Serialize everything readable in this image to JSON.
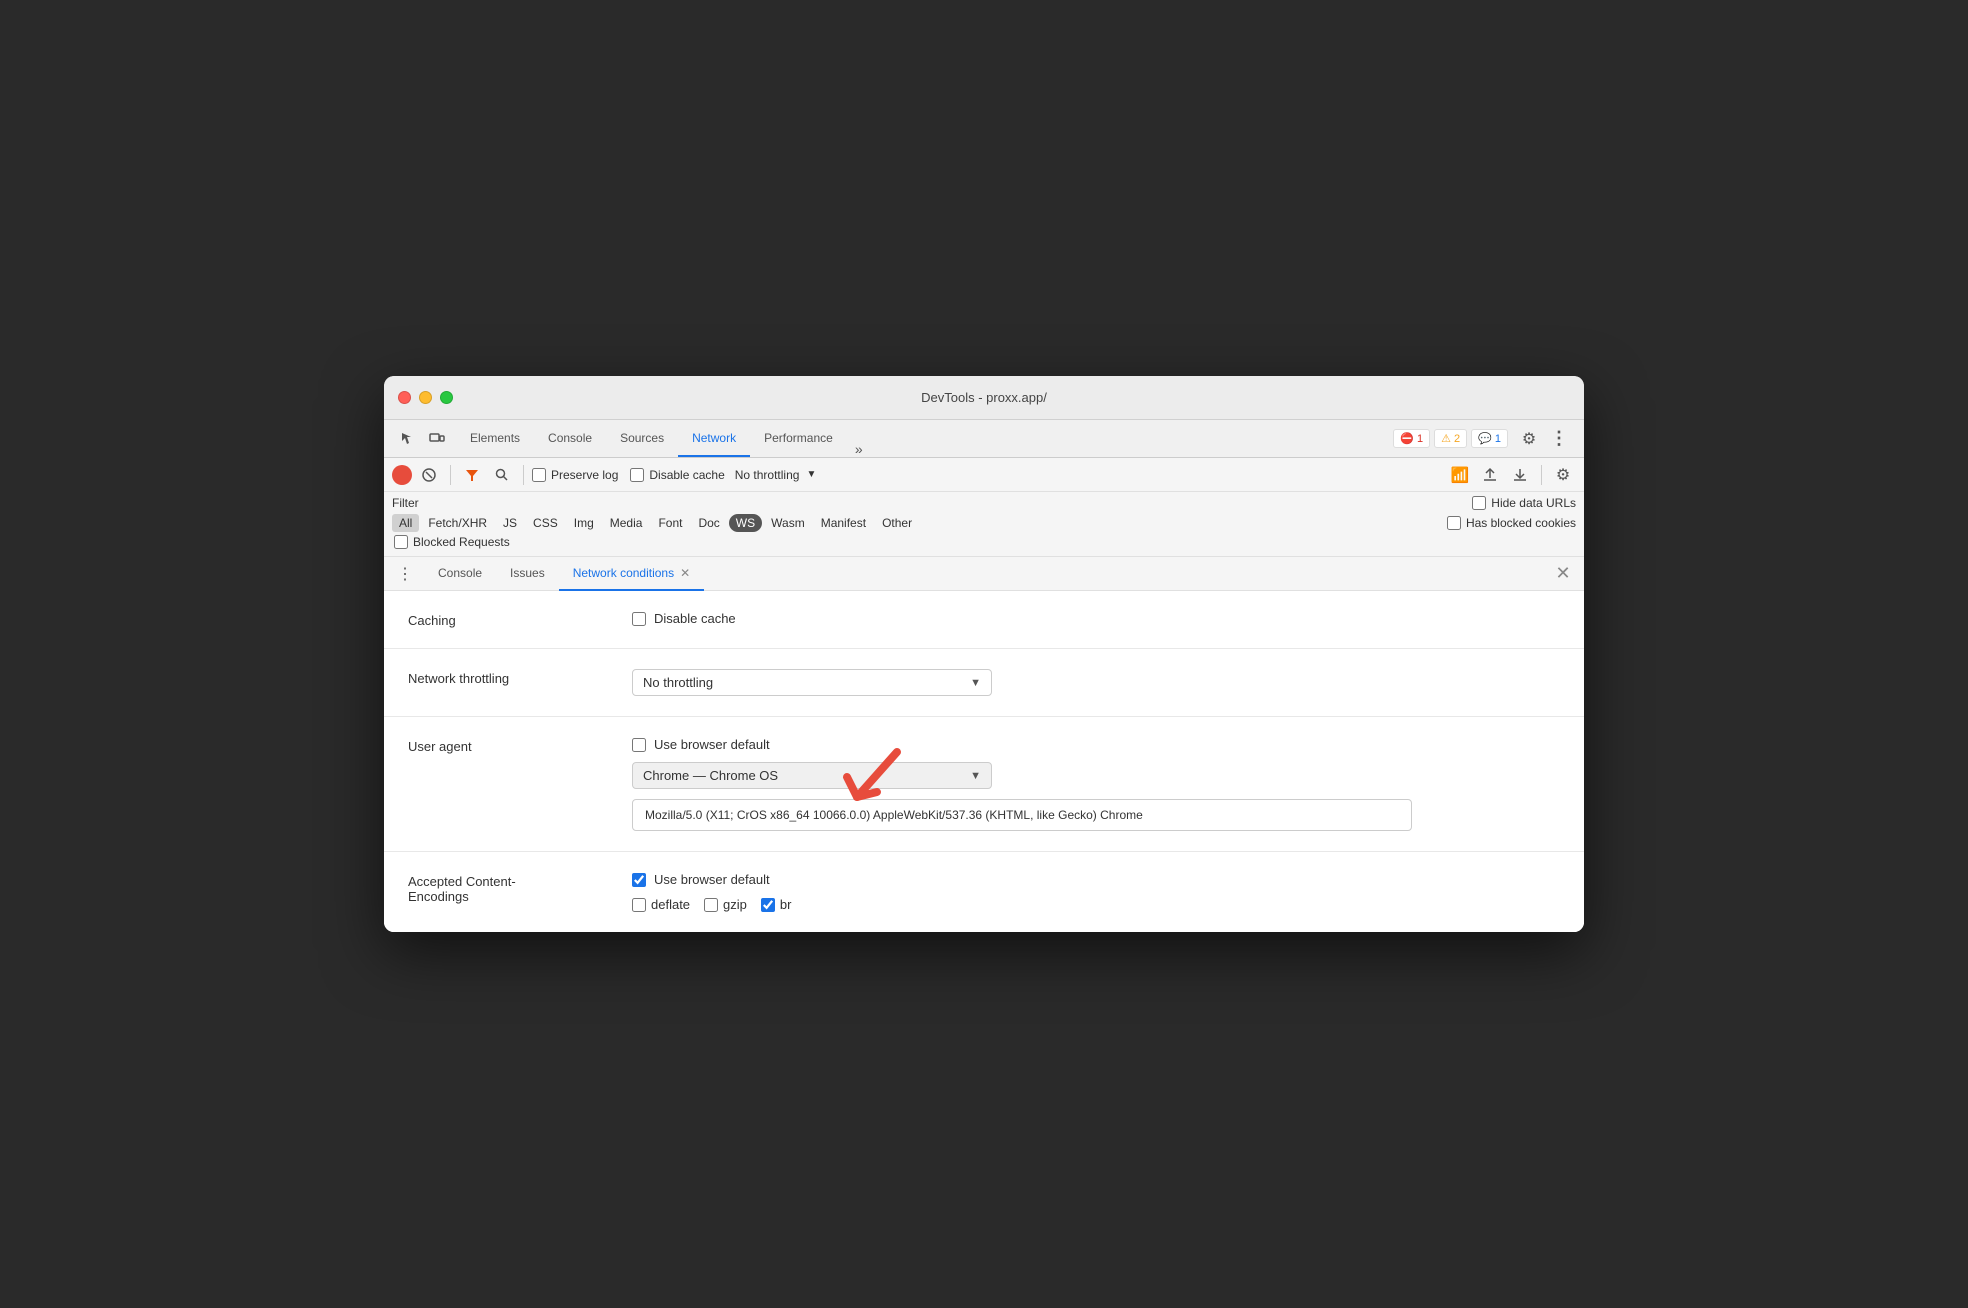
{
  "window": {
    "title": "DevTools - proxx.app/"
  },
  "traffic_lights": {
    "red": "close",
    "yellow": "minimize",
    "green": "maximize"
  },
  "devtools_tabs": {
    "items": [
      {
        "label": "Elements",
        "active": false
      },
      {
        "label": "Console",
        "active": false
      },
      {
        "label": "Sources",
        "active": false
      },
      {
        "label": "Network",
        "active": true
      },
      {
        "label": "Performance",
        "active": false
      }
    ],
    "more": "»"
  },
  "devtools_badges": {
    "errors": "1",
    "warnings": "2",
    "messages": "1"
  },
  "toolbar": {
    "preserve_log": "Preserve log",
    "disable_cache": "Disable cache",
    "throttling": "No throttling"
  },
  "filter": {
    "label": "Filter",
    "hide_data_urls": "Hide data URLs",
    "types": [
      "All",
      "Fetch/XHR",
      "JS",
      "CSS",
      "Img",
      "Media",
      "Font",
      "Doc",
      "WS",
      "Wasm",
      "Manifest",
      "Other"
    ],
    "active_type": "All",
    "ws_active": "WS",
    "has_blocked_cookies": "Has blocked cookies",
    "blocked_requests": "Blocked Requests"
  },
  "drawer_tabs": {
    "items": [
      {
        "label": "Console",
        "active": false
      },
      {
        "label": "Issues",
        "active": false
      },
      {
        "label": "Network conditions",
        "active": true,
        "closeable": true
      }
    ]
  },
  "nc_panel": {
    "caching_label": "Caching",
    "caching_disable": "Disable cache",
    "throttling_label": "Network throttling",
    "throttling_value": "No throttling",
    "user_agent_label": "User agent",
    "use_browser_default": "Use browser default",
    "user_agent_select": "Chrome — Chrome OS",
    "ua_string": "Mozilla/5.0 (X11; CrOS x86_64 10066.0.0) AppleWebKit/537.36 (KHTML, like Gecko) Chrome",
    "accepted_label": "Accepted Content-\nEncodings",
    "accepted_use_browser": "Use browser default",
    "deflate": "deflate",
    "gzip": "gzip",
    "br": "br"
  }
}
